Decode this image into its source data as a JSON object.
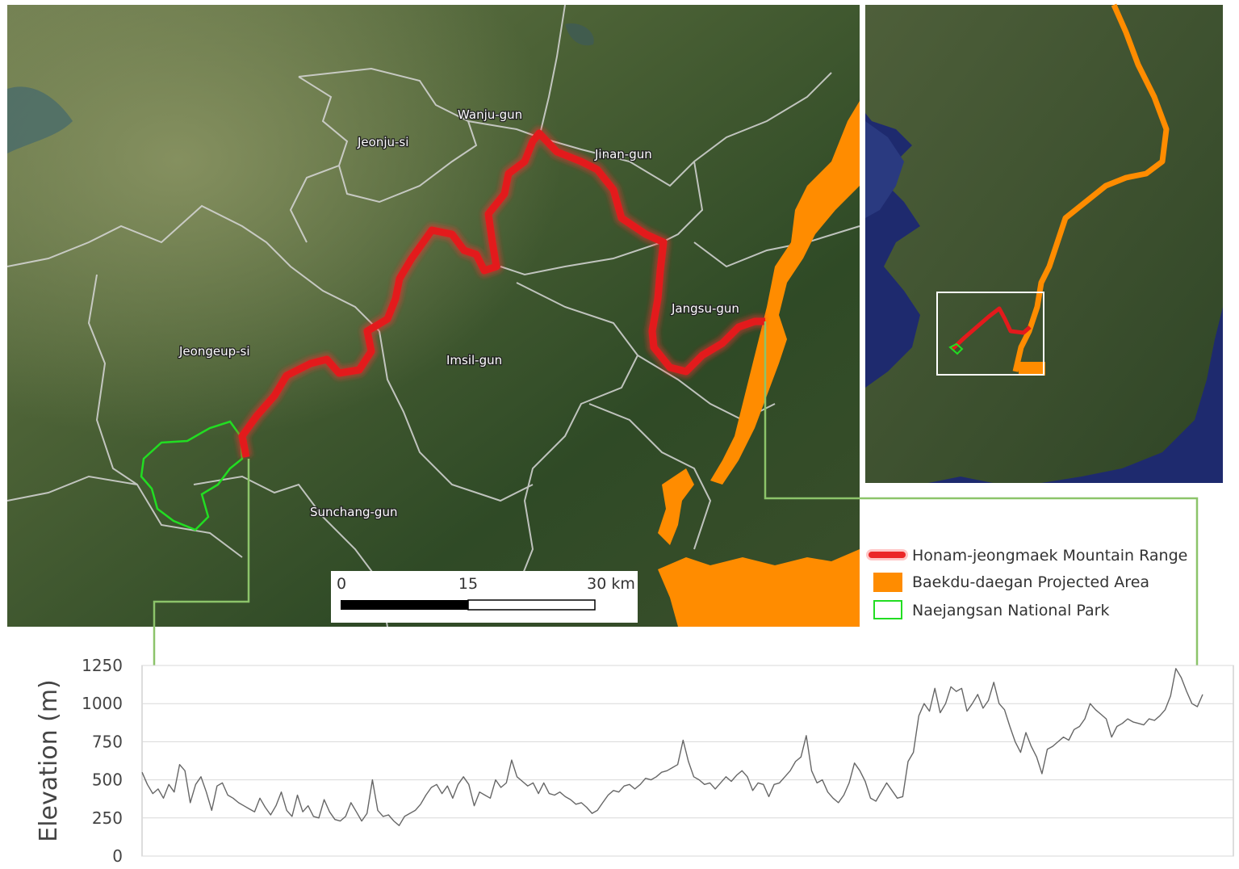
{
  "map": {
    "places": [
      "Wanju-gun",
      "Jeonju-si",
      "Jinan-gun",
      "Jangsu-gun",
      "Jeongeup-si",
      "Imsil-gun",
      "Sunchang-gun"
    ],
    "scale_bar": {
      "ticks": [
        "0",
        "15",
        "30 km"
      ]
    },
    "colors": {
      "mountain_range": "#e31a1c",
      "baekdu_area": "#ff8c00",
      "national_park": "#22dd22",
      "boundaries": "#d8d8d8",
      "connector": "#8cc46a"
    }
  },
  "legend": {
    "items": [
      {
        "label": "Honam-jeongmaek Mountain Range",
        "icon": "red-line-icon"
      },
      {
        "label": "Baekdu-daegan Projected Area",
        "icon": "orange-square-icon"
      },
      {
        "label": "Naejangsan National Park",
        "icon": "green-outline-square-icon"
      }
    ]
  },
  "chart_data": {
    "type": "line",
    "title": "",
    "xlabel": "",
    "ylabel": "Elevation (m)",
    "ylim": [
      0,
      1250
    ],
    "yticks": [
      "0",
      "250",
      "500",
      "750",
      "1000",
      "1250"
    ],
    "grid": true,
    "series": [
      {
        "color": "#666666",
        "values": [
          550,
          470,
          410,
          440,
          380,
          470,
          420,
          600,
          560,
          350,
          470,
          520,
          420,
          300,
          460,
          480,
          400,
          380,
          350,
          330,
          310,
          290,
          380,
          320,
          270,
          330,
          420,
          300,
          260,
          400,
          290,
          330,
          260,
          250,
          370,
          290,
          240,
          230,
          260,
          350,
          290,
          230,
          280,
          500,
          300,
          260,
          270,
          230,
          200,
          260,
          280,
          300,
          340,
          400,
          450,
          470,
          410,
          460,
          380,
          470,
          520,
          470,
          330,
          420,
          400,
          380,
          500,
          450,
          480,
          630,
          520,
          490,
          460,
          480,
          410,
          480,
          410,
          400,
          420,
          390,
          370,
          340,
          350,
          320,
          280,
          300,
          350,
          400,
          430,
          420,
          460,
          470,
          440,
          470,
          510,
          500,
          520,
          550,
          560,
          580,
          600,
          760,
          620,
          520,
          500,
          470,
          480,
          440,
          480,
          520,
          490,
          530,
          560,
          520,
          430,
          480,
          470,
          390,
          470,
          480,
          520,
          560,
          620,
          650,
          790,
          560,
          480,
          500,
          420,
          380,
          350,
          400,
          480,
          610,
          560,
          490,
          380,
          360,
          420,
          480,
          430,
          380,
          390,
          620,
          680,
          920,
          1000,
          950,
          1100,
          940,
          1000,
          1110,
          1080,
          1100,
          950,
          1000,
          1060,
          970,
          1020,
          1140,
          1000,
          960,
          850,
          750,
          680,
          810,
          720,
          650,
          540,
          700,
          720,
          750,
          780,
          760,
          830,
          850,
          900,
          1000,
          960,
          930,
          900,
          780,
          850,
          870,
          900,
          880,
          870,
          860,
          900,
          890,
          920,
          960,
          1050,
          1230,
          1170,
          1080,
          1000,
          980,
          1060
        ]
      }
    ]
  }
}
